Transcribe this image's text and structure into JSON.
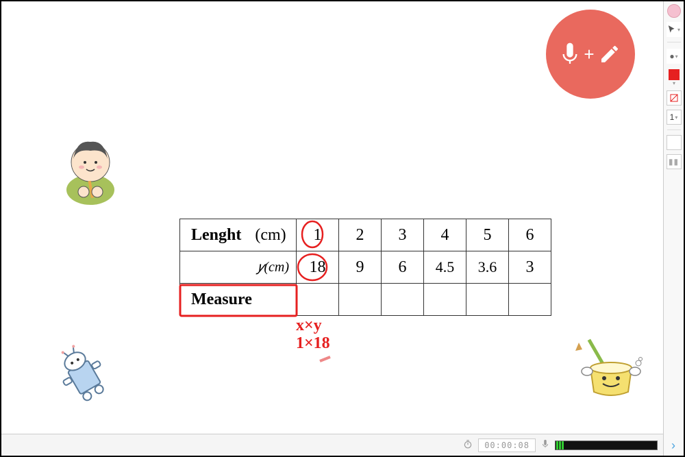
{
  "record_button": {
    "plus": "+"
  },
  "table": {
    "row1": {
      "label": "Lenght",
      "unit": "(cm)",
      "values": [
        "1",
        "2",
        "3",
        "4",
        "5",
        "6"
      ]
    },
    "row2": {
      "label": "𝑦(cm)",
      "values": [
        "18",
        "9",
        "6",
        "4.5",
        "3.6",
        "3"
      ]
    },
    "row3": {
      "label": "Measure",
      "values": [
        "",
        "",
        "",
        "",
        "",
        ""
      ]
    }
  },
  "handwriting": {
    "line1": "x×y",
    "line2": "1×18"
  },
  "bottom": {
    "timer": "00:00:08"
  },
  "toolbar": {
    "thickness": "1"
  }
}
